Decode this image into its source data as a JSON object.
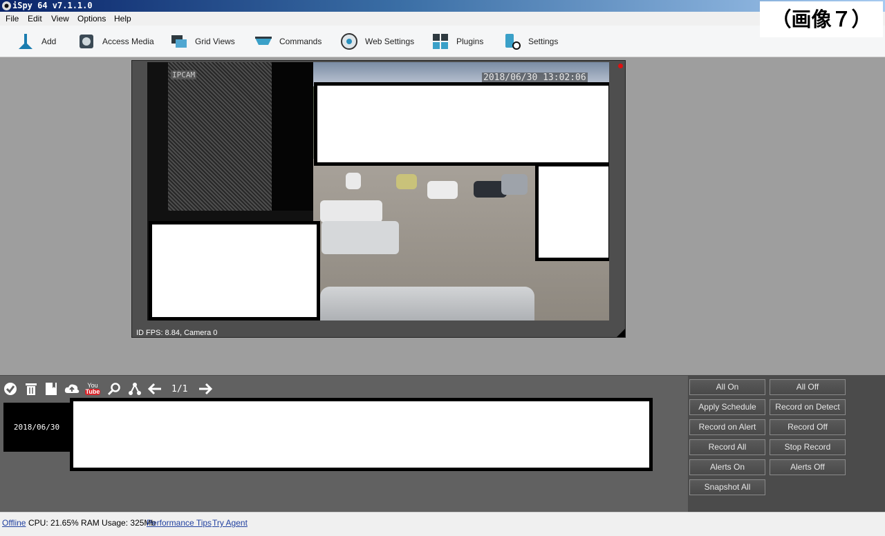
{
  "window": {
    "title": "iSpy 64 v7.1.1.0"
  },
  "overlay_label": "（画像７）",
  "menu": [
    {
      "label": "File"
    },
    {
      "label": "Edit"
    },
    {
      "label": "View"
    },
    {
      "label": "Options"
    },
    {
      "label": "Help"
    }
  ],
  "toolbar": [
    {
      "label": "Add",
      "icon": "add-icon"
    },
    {
      "label": "Access Media",
      "icon": "media-icon"
    },
    {
      "label": "Grid Views",
      "icon": "grid-views-icon"
    },
    {
      "label": "Commands",
      "icon": "commands-icon"
    },
    {
      "label": "Web Settings",
      "icon": "web-settings-icon"
    },
    {
      "label": "Plugins",
      "icon": "plugins-icon"
    },
    {
      "label": "Settings",
      "icon": "settings-icon"
    }
  ],
  "camera": {
    "osd_tag": "IPCAM",
    "osd_timestamp": "2018/06/30 13:02:06",
    "status_text": "ID  FPS: 8.84, Camera 0",
    "recording_indicator_color": "#e01010"
  },
  "media": {
    "page_counter": "1/1",
    "date_label": "2018/06/30",
    "icons": [
      "check-icon",
      "trash-icon",
      "bookmark-icon",
      "upload-cloud-icon",
      "youtube-icon",
      "search-icon",
      "share-icon",
      "arrow-left-icon",
      "arrow-right-icon"
    ],
    "youtube_icon_text": {
      "top": "You",
      "bottom": "Tube"
    }
  },
  "controls": [
    {
      "label": "All On"
    },
    {
      "label": "All Off"
    },
    {
      "label": "Apply Schedule"
    },
    {
      "label": "Record on Detect"
    },
    {
      "label": "Record on Alert"
    },
    {
      "label": "Record Off"
    },
    {
      "label": "Record All"
    },
    {
      "label": "Stop Record"
    },
    {
      "label": "Alerts On"
    },
    {
      "label": "Alerts Off"
    },
    {
      "label": "Snapshot All"
    }
  ],
  "status": {
    "offline": "Offline",
    "cpu_ram": "CPU: 21.65% RAM Usage: 325Mb",
    "performance_tips": "Performance Tips",
    "try_agent": "Try Agent"
  }
}
